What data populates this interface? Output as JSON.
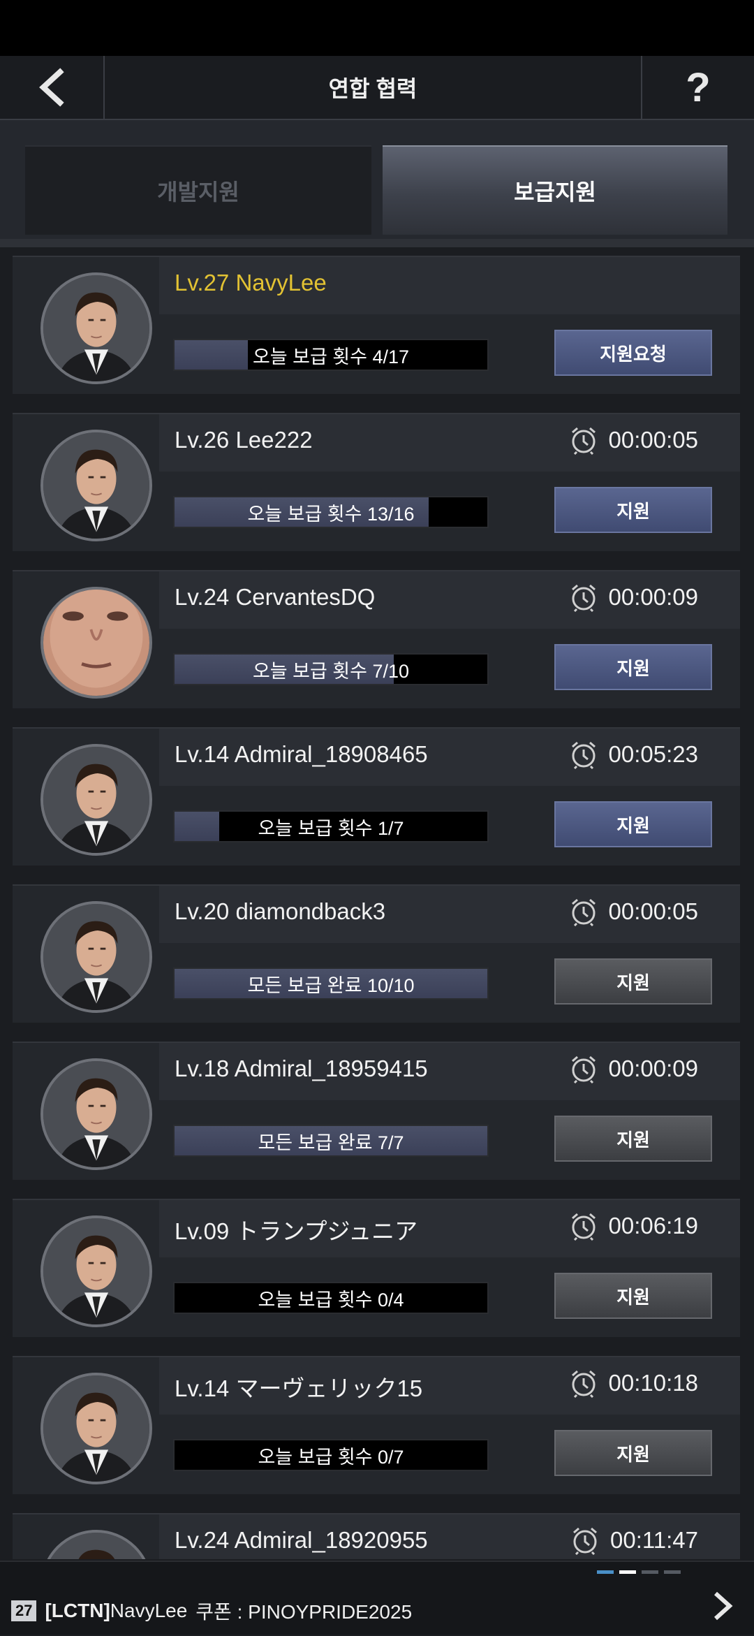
{
  "header": {
    "title": "연합 협력",
    "help_label": "?"
  },
  "tabs": [
    {
      "label": "개발지원",
      "active": false
    },
    {
      "label": "보급지원",
      "active": true
    }
  ],
  "members": [
    {
      "name": "Lv.27 NavyLee",
      "self": true,
      "timer": "",
      "progress_text": "오늘 보급 횟수 4/17",
      "progress_fraction": 0.235,
      "button": "지원요청",
      "button_style": "blue",
      "avatar": "default"
    },
    {
      "name": "Lv.26 Lee222",
      "timer": "00:00:05",
      "progress_text": "오늘 보급 횟수 13/16",
      "progress_fraction": 0.8125,
      "button": "지원",
      "button_style": "blue",
      "avatar": "default"
    },
    {
      "name": "Lv.24 CervantesDQ",
      "timer": "00:00:09",
      "progress_text": "오늘 보급 횟수 7/10",
      "progress_fraction": 0.7,
      "button": "지원",
      "button_style": "blue",
      "avatar": "face"
    },
    {
      "name": "Lv.14 Admiral_18908465",
      "timer": "00:05:23",
      "progress_text": "오늘 보급 횟수 1/7",
      "progress_fraction": 0.143,
      "button": "지원",
      "button_style": "blue",
      "avatar": "default"
    },
    {
      "name": "Lv.20 diamondback3",
      "timer": "00:00:05",
      "progress_text": "모든 보급 완료 10/10",
      "progress_fraction": 1.0,
      "button": "지원",
      "button_style": "gray",
      "avatar": "default"
    },
    {
      "name": "Lv.18 Admiral_18959415",
      "timer": "00:00:09",
      "progress_text": "모든 보급 완료 7/7",
      "progress_fraction": 1.0,
      "button": "지원",
      "button_style": "gray",
      "avatar": "default"
    },
    {
      "name": "Lv.09 トランプジュニア",
      "timer": "00:06:19",
      "progress_text": "오늘 보급 횟수 0/4",
      "progress_fraction": 0.0,
      "button": "지원",
      "button_style": "gray",
      "avatar": "default"
    },
    {
      "name": "Lv.14 マーヴェリック15",
      "timer": "00:10:18",
      "progress_text": "오늘 보급 횟수 0/7",
      "progress_fraction": 0.0,
      "button": "지원",
      "button_style": "gray",
      "avatar": "default"
    },
    {
      "name": "Lv.24 Admiral_18920955",
      "timer": "00:11:47",
      "progress_text": "",
      "progress_fraction": 0.0,
      "button": "",
      "button_style": "gray",
      "avatar": "default"
    }
  ],
  "footer": {
    "level_badge": "27",
    "guild_tag": "[LCTN]",
    "player": "NavyLee",
    "coupon_text": "쿠폰 : PINOYPRIDE2025",
    "page_count": 4,
    "page_active": 1
  },
  "colors": {
    "self_name": "#e2c233",
    "button_blue": "#4a5580",
    "button_gray": "#4a4c50",
    "progress_fill": "#434962"
  }
}
